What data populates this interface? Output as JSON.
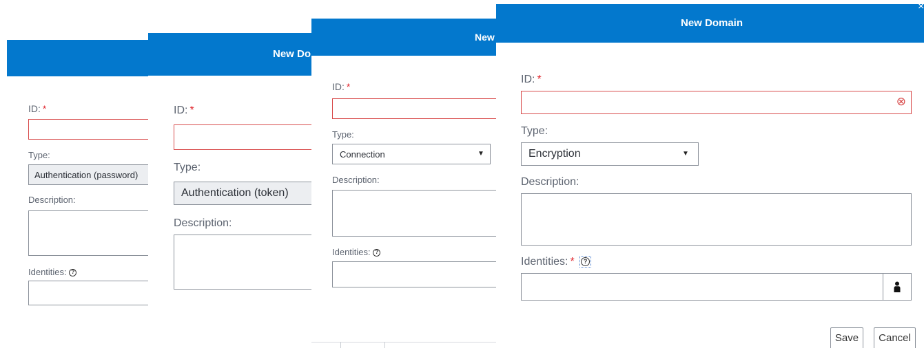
{
  "dialog1": {
    "id_label": "ID:",
    "required": "*",
    "type_label": "Type:",
    "type_value": "Authentication (password)",
    "description_label": "Description:",
    "identities_label": "Identities:",
    "help_glyph": "?"
  },
  "dialog2": {
    "title": "New Domain",
    "id_label": "ID:",
    "required": "*",
    "type_label": "Type:",
    "type_value": "Authentication (token)",
    "description_label": "Description:"
  },
  "dialog3": {
    "title": "New Domain",
    "id_label": "ID:",
    "required": "*",
    "type_label": "Type:",
    "type_value": "Connection",
    "description_label": "Description:",
    "identities_label": "Identities:",
    "help_glyph": "?",
    "caret": "▼"
  },
  "dialog4": {
    "title": "New Domain",
    "close_glyph": "×",
    "id_label": "ID:",
    "required": "*",
    "clear_glyph": "⊗",
    "type_label": "Type:",
    "type_value": "Encryption",
    "caret": "▼",
    "description_label": "Description:",
    "identities_label": "Identities:",
    "help_glyph": "?",
    "save_label": "Save",
    "cancel_label": "Cancel"
  },
  "colors": {
    "header": "#0378cd",
    "error_border": "#d84a4a",
    "required": "#e0262d"
  }
}
